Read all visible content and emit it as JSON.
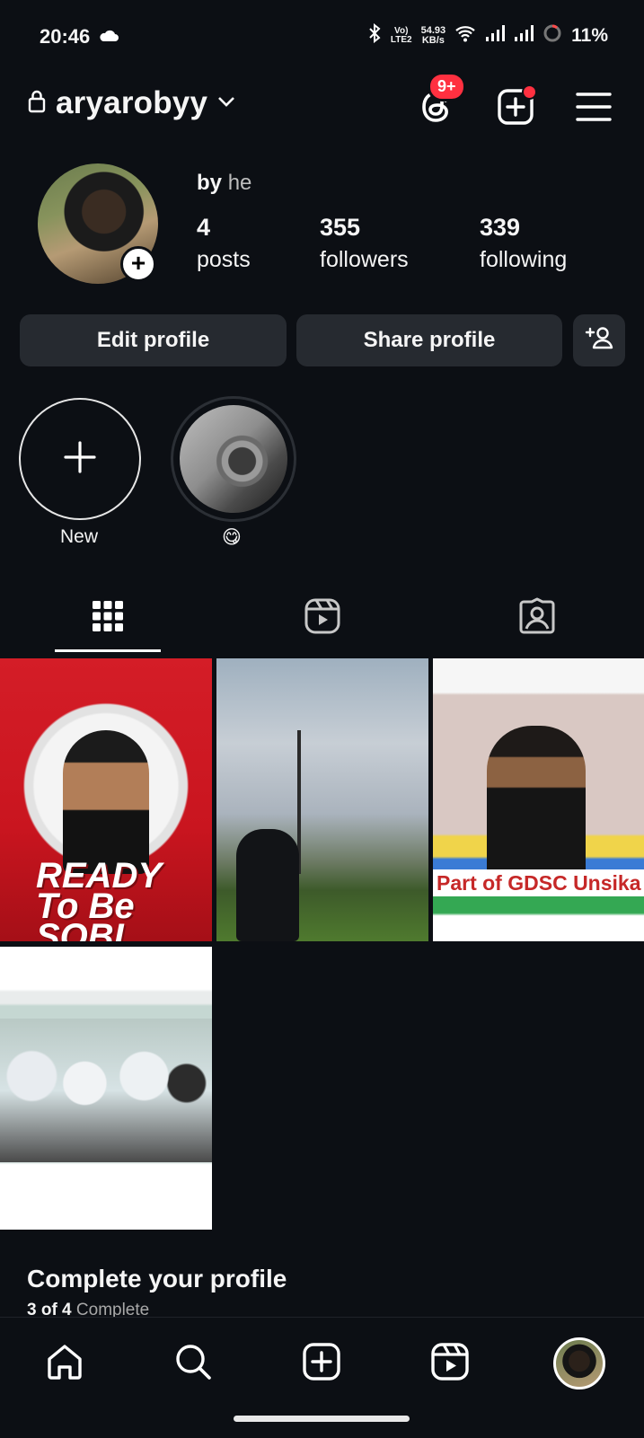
{
  "status_bar": {
    "time": "20:46",
    "volte_top": "Vo)",
    "volte_bottom": "LTE2",
    "speed_value": "54.93",
    "speed_unit": "KB/s",
    "battery": "11%"
  },
  "header": {
    "username": "aryarobyy",
    "threads_badge": "9+"
  },
  "profile": {
    "bio_by": "by",
    "bio_text": "he",
    "stats": [
      {
        "value": "4",
        "label": "posts"
      },
      {
        "value": "355",
        "label": "followers"
      },
      {
        "value": "339",
        "label": "following"
      }
    ]
  },
  "actions": {
    "edit_label": "Edit profile",
    "share_label": "Share profile"
  },
  "highlights": [
    {
      "label": "New"
    },
    {
      "label": "😋"
    }
  ],
  "posts": [
    {
      "overlay_text": "READY To Be SOBI"
    },
    {
      "overlay_text": ""
    },
    {
      "overlay_text": "Part of GDSC Unsika"
    },
    {
      "overlay_text": ""
    }
  ],
  "complete_profile": {
    "title": "Complete your profile",
    "progress": "3 of 4",
    "progress_suffix": "Complete"
  },
  "colors": {
    "background": "#0c0f14",
    "button": "#262a30",
    "badge": "#ff3040"
  }
}
